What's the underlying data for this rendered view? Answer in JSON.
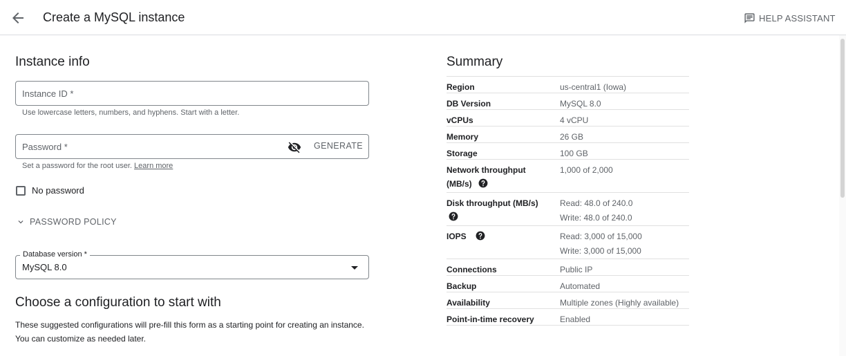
{
  "header": {
    "title": "Create a MySQL instance",
    "help_label": "HELP ASSISTANT",
    "back_icon": "arrow-back-icon",
    "help_icon": "chat-icon"
  },
  "instance_info": {
    "heading": "Instance info",
    "instance_id": {
      "placeholder": "Instance ID *",
      "value": "",
      "hint": "Use lowercase letters, numbers, and hyphens. Start with a letter."
    },
    "password": {
      "placeholder": "Password *",
      "value": "",
      "hint": "Set a password for the root user.",
      "hint_link": "Learn more",
      "generate_label": "GENERATE"
    },
    "no_password": {
      "label": "No password",
      "checked": false
    },
    "password_policy": "PASSWORD POLICY",
    "db_version": {
      "label": "Database version *",
      "value": "MySQL 8.0"
    }
  },
  "config": {
    "heading": "Choose a configuration to start with",
    "description": "These suggested configurations will pre-fill this form as a starting point for creating an instance. You can customize as needed later."
  },
  "summary": {
    "heading": "Summary",
    "rows": [
      {
        "label": "Region",
        "value": "us-central1 (Iowa)"
      },
      {
        "label": "DB Version",
        "value": "MySQL 8.0"
      },
      {
        "label": "vCPUs",
        "value": "4 vCPU"
      },
      {
        "label": "Memory",
        "value": "26 GB"
      },
      {
        "label": "Storage",
        "value": "100 GB"
      },
      {
        "label": "Network throughput (MB/s)",
        "value": "1,000 of 2,000"
      },
      {
        "label": "Disk throughput (MB/s)",
        "value": "Read: 48.0 of 240.0",
        "value2": "Write: 48.0 of 240.0"
      },
      {
        "label": "IOPS",
        "value": "Read: 3,000 of 15,000",
        "value2": "Write: 3,000 of 15,000"
      },
      {
        "label": "Connections",
        "value": "Public IP"
      },
      {
        "label": "Backup",
        "value": "Automated"
      },
      {
        "label": "Availability",
        "value": "Multiple zones (Highly available)"
      },
      {
        "label": "Point-in-time recovery",
        "value": "Enabled"
      }
    ]
  },
  "colors": {
    "text": "#202124",
    "secondary": "#5f6368",
    "border": "#80868b",
    "divider": "#e0e0e0"
  }
}
